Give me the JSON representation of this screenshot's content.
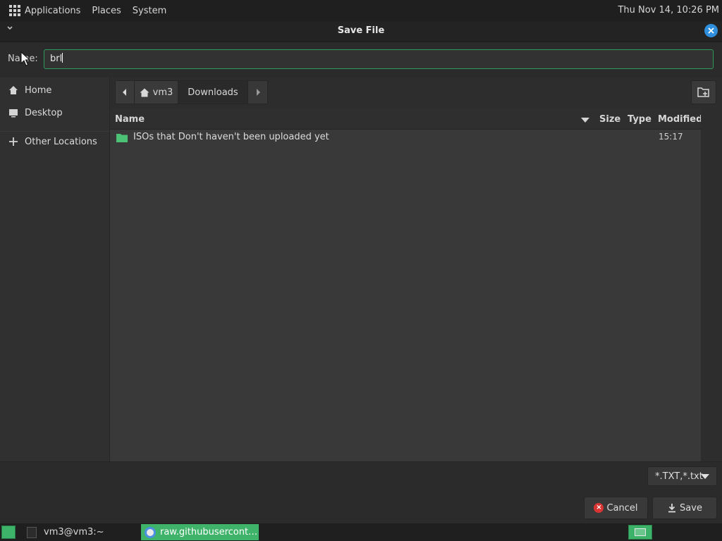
{
  "top_panel": {
    "menus": [
      "Applications",
      "Places",
      "System"
    ],
    "clock": "Thu Nov 14, 10:26 PM"
  },
  "dialog": {
    "title": "Save File",
    "name_label": "Name:",
    "name_value": "brl",
    "sidebar": [
      {
        "label": "Home",
        "icon": "home-icon"
      },
      {
        "label": "Desktop",
        "icon": "desktop-icon"
      },
      {
        "label": "Other Locations",
        "icon": "plus-icon"
      }
    ],
    "path": {
      "segments": [
        "vm3",
        "Downloads"
      ],
      "active": "Downloads"
    },
    "columns": [
      "Name",
      "Size",
      "Type",
      "Modified"
    ],
    "files": [
      {
        "name": "ISOs that Don't haven't been uploaded yet",
        "size": "",
        "type": "",
        "modified": "15:17",
        "icon": "folder-icon"
      }
    ],
    "filter": "*.TXT,*.txt",
    "buttons": {
      "cancel": "Cancel",
      "save": "Save"
    }
  },
  "taskbar": {
    "items": [
      "vm3@vm3:~",
      "raw.githubusercont…"
    ]
  },
  "colors": {
    "accent": "#3db36a",
    "close_button": "#2f8fdc",
    "cancel_icon": "#d83434",
    "folder": "#4cc277"
  }
}
